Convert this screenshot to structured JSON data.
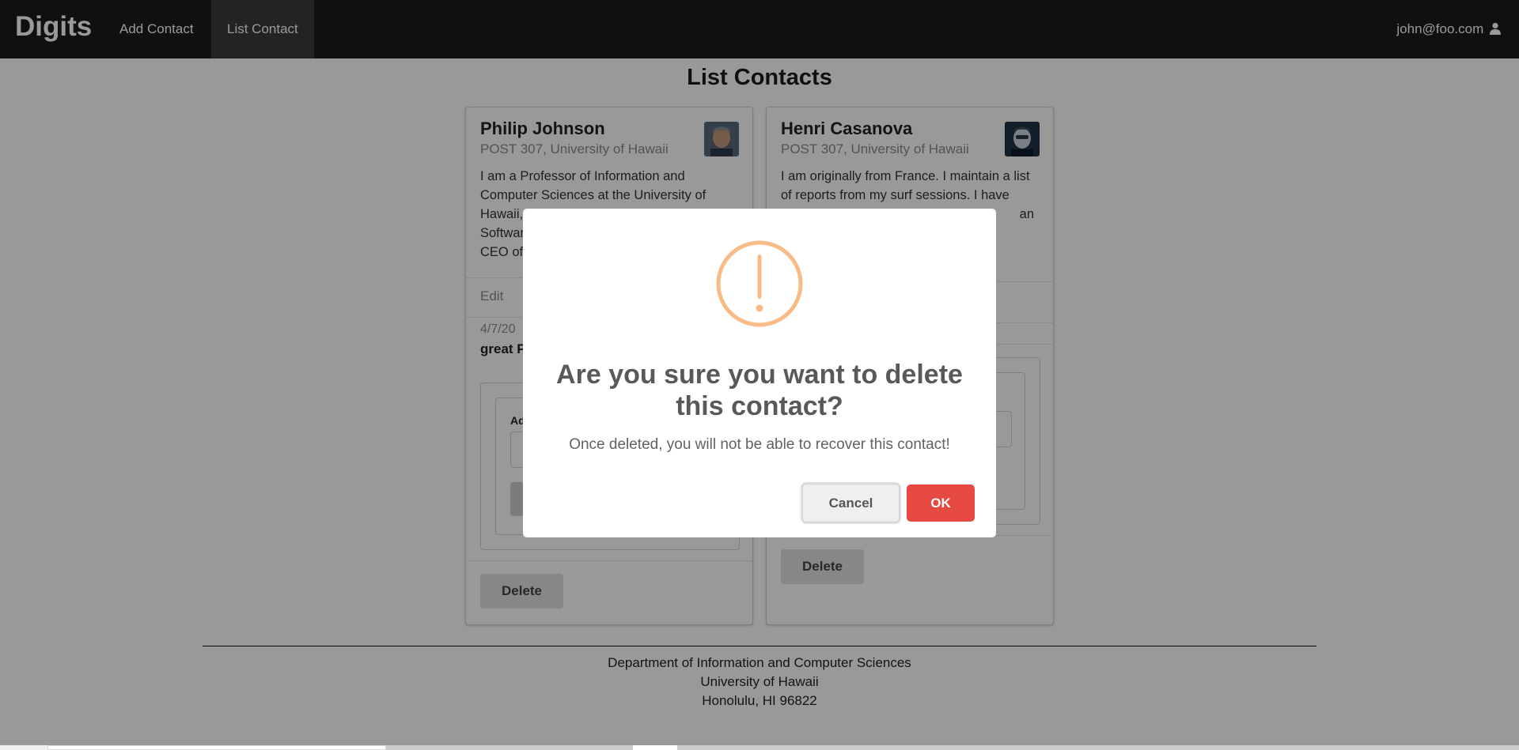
{
  "navbar": {
    "brand": "Digits",
    "items": [
      "Add Contact",
      "List Contact"
    ],
    "user": "john@foo.com"
  },
  "page": {
    "title": "List Contacts"
  },
  "cards": [
    {
      "name": "Philip Johnson",
      "address": "POST 307, University of Hawaii",
      "description": "I am a Professor of Information and Computer Sciences at the University of Hawaii, Director of the Collaborative Software Development Laboratory, and the CEO of OpenPowerQuality.com.",
      "edit": "Edit",
      "note_date": "4/7/20",
      "note_text": "great P",
      "note_label": "Ad",
      "delete": "Delete"
    },
    {
      "name": "Henri Casanova",
      "address": "POST 307, University of Hawaii",
      "description": "I am originally from France. I maintain a list of reports from my surf sessions. I have",
      "description_tail": "an",
      "delete": "Delete"
    }
  ],
  "footer": {
    "line1": "Department of Information and Computer Sciences",
    "line2": "University of Hawaii",
    "line3": "Honolulu, HI 96822"
  },
  "modal": {
    "title": "Are you sure you want to delete this contact?",
    "text": "Once deleted, you will not be able to recover this contact!",
    "cancel": "Cancel",
    "ok": "OK",
    "icon": "warning-icon",
    "icon_color": "#f8bb86",
    "ok_color": "#e64942"
  }
}
